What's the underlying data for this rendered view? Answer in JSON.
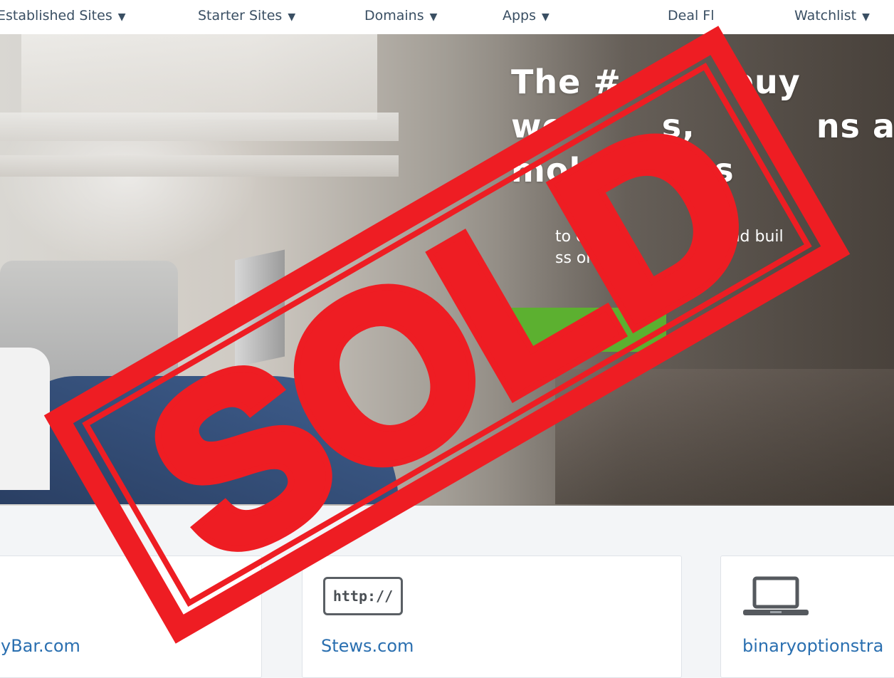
{
  "nav": {
    "items": [
      {
        "label": "Established Sites",
        "caret": "▼"
      },
      {
        "label": "Starter Sites",
        "caret": "▼"
      },
      {
        "label": "Domains",
        "caret": "▼"
      },
      {
        "label": "Apps",
        "caret": "▼"
      },
      {
        "label": "Deal Fl",
        "caret": ""
      },
      {
        "label": "Watchlist",
        "caret": "▼"
      }
    ]
  },
  "hero": {
    "headline": "The #         buy\nwe        s,          ns a\nmobi       ps",
    "subtext": "to earn                   e and buil\nss online",
    "cta_label": "d"
  },
  "listings": [
    {
      "title": "yBar.com",
      "icon": "globe-icon"
    },
    {
      "title": "Stews.com",
      "icon": "http-badge-icon",
      "badge_text": "http://"
    },
    {
      "title": "binaryoptionstra",
      "icon": "laptop-icon"
    }
  ],
  "overlay": {
    "stamp_text": "SOLD",
    "color": "#ee1d23"
  },
  "colors": {
    "nav_text": "#3a4f63",
    "link": "#2a6fb0",
    "cta_green": "#5cb030"
  }
}
